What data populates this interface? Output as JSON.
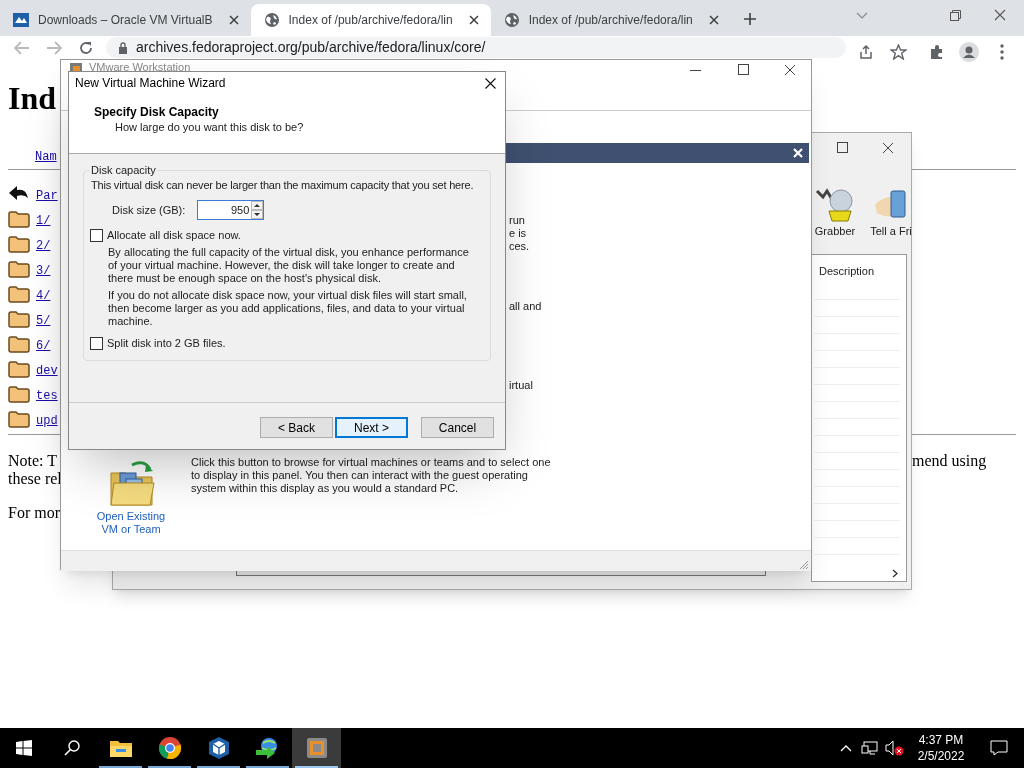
{
  "browser": {
    "tabs": [
      {
        "title": "Downloads – Oracle VM VirtualB",
        "kind": "virtualbox",
        "selected": false
      },
      {
        "title": "Index of /pub/archive/fedora/lin",
        "kind": "globe",
        "selected": true
      },
      {
        "title": "Index of /pub/archive/fedora/lin",
        "kind": "globe",
        "selected": false
      }
    ],
    "address": "archives.fedoraproject.org/pub/archive/fedora/linux/core/"
  },
  "page": {
    "heading": "Ind",
    "column_header": "Nam",
    "entries": [
      {
        "label": "Par",
        "kind": "parent"
      },
      {
        "label": "1/",
        "kind": "folder"
      },
      {
        "label": "2/",
        "kind": "folder"
      },
      {
        "label": "3/",
        "kind": "folder"
      },
      {
        "label": "4/",
        "kind": "folder"
      },
      {
        "label": "5/",
        "kind": "folder"
      },
      {
        "label": "6/",
        "kind": "folder"
      },
      {
        "label": "dev",
        "kind": "folder"
      },
      {
        "label": "tes",
        "kind": "folder"
      },
      {
        "label": "upd",
        "kind": "folder"
      }
    ],
    "note_lines": [
      "Note: T",
      "these rel"
    ],
    "note_right": "mend using",
    "footer": "For mor"
  },
  "back_window": {
    "toolbar": [
      {
        "label": "Grabber",
        "kind": "grabber"
      },
      {
        "label": "Tell a Fri",
        "kind": "phone"
      }
    ],
    "list_header": "Description"
  },
  "vmware": {
    "title": "VMware Workstation",
    "fragments": [
      "run",
      "e is",
      "ces.",
      "all and",
      "irtual"
    ],
    "open_label": "Open Existing VM or Team",
    "open_description": "Click this button to browse for virtual machines or teams and to select one to display in this panel. You then can interact with the guest operating system within this display as you would a standard PC."
  },
  "wizard": {
    "title": "New Virtual Machine Wizard",
    "heading": "Specify Disk Capacity",
    "subheading": "How large do you want this disk to be?",
    "group": "Disk capacity",
    "intro": "This virtual disk can never be larger than the maximum capacity that you set here.",
    "size_label": "Disk size (GB):",
    "size_value": "950",
    "options": [
      {
        "label": "Allocate all disk space now.",
        "checked": false,
        "notes": [
          "By allocating the full capacity of the virtual disk, you enhance performance of your virtual machine.  However, the disk will take longer to create and there must be enough space on the host's physical disk.",
          "If you do not allocate disk space now, your virtual disk files will start small, then become larger as you add applications, files, and data to your virtual machine."
        ]
      },
      {
        "label": "Split disk into 2 GB files.",
        "checked": false
      }
    ],
    "buttons": [
      {
        "label": "< Back",
        "default": false
      },
      {
        "label": "Next >",
        "default": true
      },
      {
        "label": "Cancel",
        "default": false
      }
    ]
  },
  "taskbar": {
    "apps": [
      {
        "kind": "explorer",
        "selected": false
      },
      {
        "kind": "chrome",
        "selected": false
      },
      {
        "kind": "virtualbox",
        "selected": false
      },
      {
        "kind": "downloader",
        "selected": false
      },
      {
        "kind": "vmware",
        "selected": true
      }
    ],
    "time": "4:37 PM",
    "date": "2/5/2022"
  }
}
